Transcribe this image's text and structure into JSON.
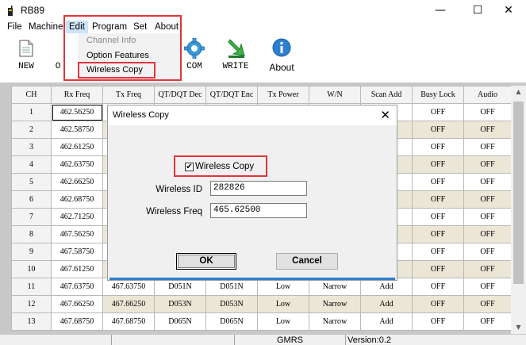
{
  "window": {
    "title": "RB89",
    "minimize": "—",
    "maximize": "☐",
    "close": "✕"
  },
  "menu": {
    "items": [
      {
        "label": "File"
      },
      {
        "label": "Machine"
      },
      {
        "label": "Edit"
      },
      {
        "label": "Program"
      },
      {
        "label": "Set"
      },
      {
        "label": "About"
      }
    ],
    "edit_dropdown": [
      {
        "label": "Channel Info",
        "enabled": false
      },
      {
        "label": "Option Features",
        "enabled": true
      },
      {
        "label": "Wireless Copy",
        "enabled": true
      }
    ]
  },
  "toolbar": {
    "new_label": "NEW",
    "open_label_partial": "O",
    "com_label": "COM",
    "write_label": "WRITE",
    "about_label": "About",
    "icons": [
      "new-file-icon",
      "open-icon",
      "gear-icon",
      "write-arrow-icon",
      "info-icon"
    ]
  },
  "grid": {
    "columns": [
      "CH",
      "Rx Freq",
      "Tx Freq",
      "QT/DQT Dec",
      "QT/DQT Enc",
      "Tx Power",
      "W/N",
      "Scan Add",
      "Busy Lock",
      "Audio"
    ],
    "rows": [
      {
        "ch": "1",
        "rx": "462.56250",
        "tx": "",
        "dec": "",
        "enc": "",
        "power": "",
        "wn": "",
        "scan": "",
        "busy": "OFF",
        "audio": "OFF"
      },
      {
        "ch": "2",
        "rx": "462.58750",
        "tx": "",
        "dec": "",
        "enc": "",
        "power": "",
        "wn": "",
        "scan": "",
        "busy": "OFF",
        "audio": "OFF"
      },
      {
        "ch": "3",
        "rx": "462.61250",
        "tx": "",
        "dec": "",
        "enc": "",
        "power": "",
        "wn": "",
        "scan": "",
        "busy": "OFF",
        "audio": "OFF"
      },
      {
        "ch": "4",
        "rx": "462.63750",
        "tx": "",
        "dec": "",
        "enc": "",
        "power": "",
        "wn": "",
        "scan": "",
        "busy": "OFF",
        "audio": "OFF"
      },
      {
        "ch": "5",
        "rx": "462.66250",
        "tx": "",
        "dec": "",
        "enc": "",
        "power": "",
        "wn": "",
        "scan": "",
        "busy": "OFF",
        "audio": "OFF"
      },
      {
        "ch": "6",
        "rx": "462.68750",
        "tx": "",
        "dec": "",
        "enc": "",
        "power": "",
        "wn": "",
        "scan": "",
        "busy": "OFF",
        "audio": "OFF"
      },
      {
        "ch": "7",
        "rx": "462.71250",
        "tx": "",
        "dec": "",
        "enc": "",
        "power": "",
        "wn": "",
        "scan": "",
        "busy": "OFF",
        "audio": "OFF"
      },
      {
        "ch": "8",
        "rx": "467.56250",
        "tx": "",
        "dec": "",
        "enc": "",
        "power": "",
        "wn": "",
        "scan": "",
        "busy": "OFF",
        "audio": "OFF"
      },
      {
        "ch": "9",
        "rx": "467.58750",
        "tx": "",
        "dec": "",
        "enc": "",
        "power": "",
        "wn": "",
        "scan": "",
        "busy": "OFF",
        "audio": "OFF"
      },
      {
        "ch": "10",
        "rx": "467.61250",
        "tx": "",
        "dec": "",
        "enc": "",
        "power": "",
        "wn": "",
        "scan": "",
        "busy": "OFF",
        "audio": "OFF"
      },
      {
        "ch": "11",
        "rx": "467.63750",
        "tx": "467.63750",
        "dec": "D051N",
        "enc": "D051N",
        "power": "Low",
        "wn": "Narrow",
        "scan": "Add",
        "busy": "OFF",
        "audio": "OFF"
      },
      {
        "ch": "12",
        "rx": "467.66250",
        "tx": "467.66250",
        "dec": "D053N",
        "enc": "D053N",
        "power": "Low",
        "wn": "Narrow",
        "scan": "Add",
        "busy": "OFF",
        "audio": "OFF"
      },
      {
        "ch": "13",
        "rx": "467.68750",
        "tx": "467.68750",
        "dec": "D065N",
        "enc": "D065N",
        "power": "Low",
        "wn": "Narrow",
        "scan": "Add",
        "busy": "OFF",
        "audio": "OFF"
      }
    ]
  },
  "status": {
    "band": "GMRS",
    "version": "Version:0.2"
  },
  "dialog": {
    "title": "Wireless Copy",
    "close": "✕",
    "checkbox_label": "Wireless Copy",
    "checkbox_checked": true,
    "checkbox_mark": "✔",
    "id_label": "Wireless ID",
    "id_value": "282826",
    "freq_label": "Wireless Freq",
    "freq_value": "465.62500",
    "ok_label": "OK",
    "cancel_label": "Cancel"
  },
  "colors": {
    "highlight_red": "#e0353c",
    "accent_blue": "#2f7fd0",
    "row_alt": "#ebe6d6"
  }
}
